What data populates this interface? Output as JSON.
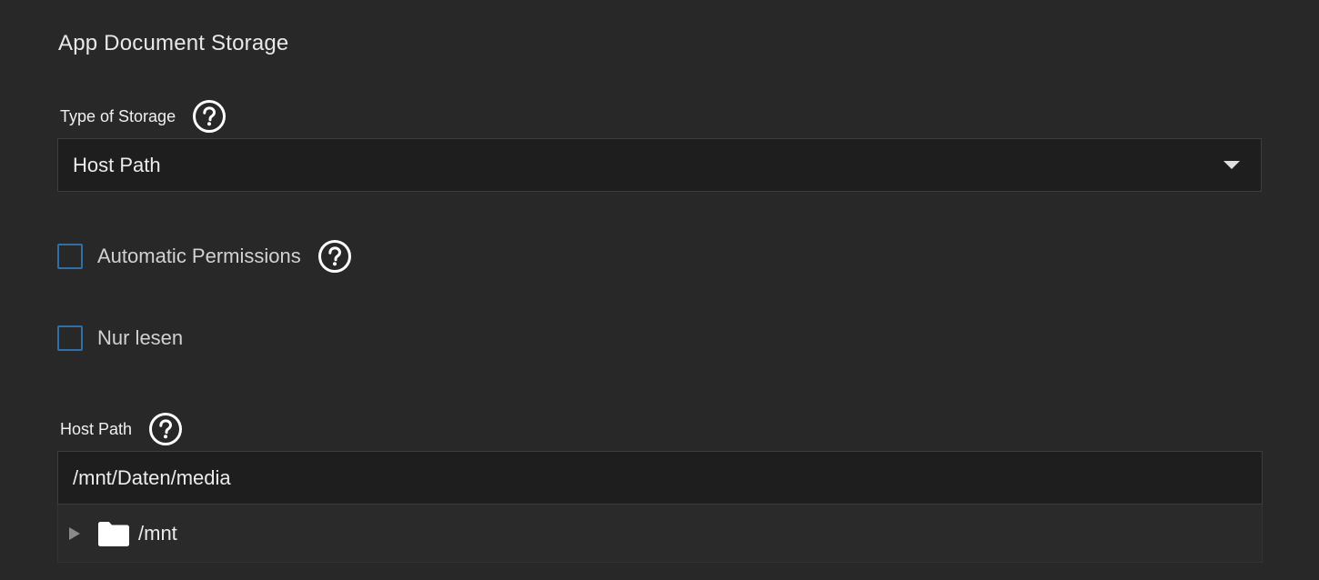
{
  "section": {
    "title": "App Document Storage"
  },
  "storage_type": {
    "label": "Type of Storage",
    "help_icon": "help-circle-icon",
    "selected_value": "Host Path"
  },
  "automatic_permissions": {
    "label": "Automatic Permissions",
    "checked": false,
    "help_icon": "help-circle-icon"
  },
  "read_only": {
    "label": "Nur lesen",
    "checked": false
  },
  "host_path": {
    "label": "Host Path",
    "help_icon": "help-circle-icon",
    "value": "/mnt/Daten/media"
  },
  "file_tree": {
    "nodes": [
      {
        "label": "/mnt",
        "icon": "folder-icon",
        "expanded": false
      }
    ]
  },
  "colors": {
    "background": "#282828",
    "field_background": "#1e1e1e",
    "checkbox_border": "#2f6fa6",
    "text": "#e6e6e6"
  }
}
